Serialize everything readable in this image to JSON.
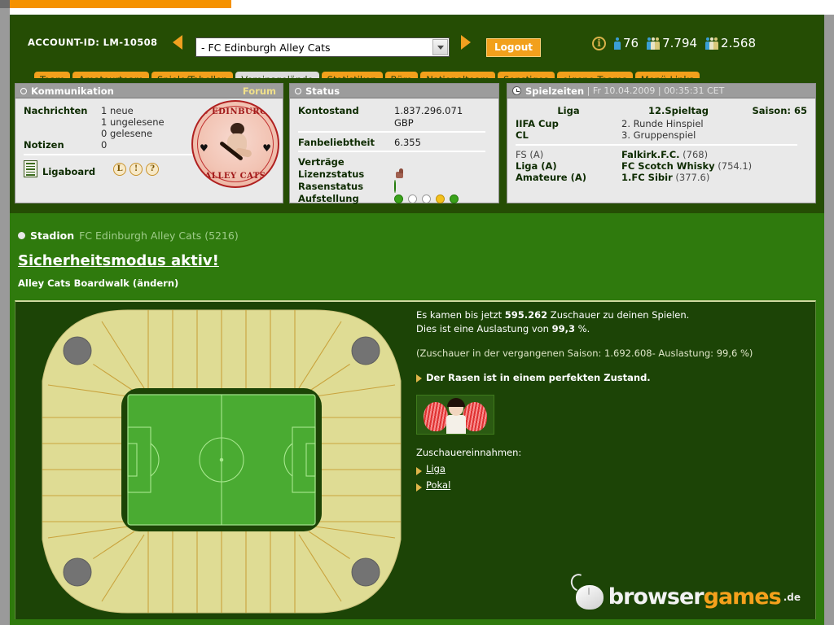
{
  "header": {
    "account_label": "ACCOUNT-ID: LM-10508",
    "team_select_value": "- FC Edinburgh Alley Cats",
    "logout_label": "Logout",
    "info_icon": "info-circle-icon",
    "stat_online": "76",
    "stat_users": "7.794",
    "stat_teams": "2.568"
  },
  "tabs": [
    {
      "label": "Team",
      "active": false
    },
    {
      "label": "Amateurteam",
      "active": false
    },
    {
      "label": "Spiele/Tabellen",
      "active": false
    },
    {
      "label": "Vereinsgelände",
      "active": true
    },
    {
      "label": "Statistiken",
      "active": false
    },
    {
      "label": "Büro",
      "active": false
    },
    {
      "label": "Nationalteam",
      "active": false
    },
    {
      "label": "Sonstiges",
      "active": false
    },
    {
      "label": "eigene Teams",
      "active": false
    },
    {
      "label": "Menü-Links",
      "active": false
    }
  ],
  "kommunikation": {
    "title": "Kommunikation",
    "forum_link": "Forum",
    "nachrichten_label": "Nachrichten",
    "nachrichten_new": "1 neue",
    "nachrichten_unread": "1 ungelesene",
    "nachrichten_read": "0 gelesene",
    "notizen_label": "Notizen",
    "notizen_value": "0",
    "ligaboard_label": "Ligaboard",
    "ligaboard_buttons": [
      "L",
      "!",
      "?"
    ],
    "emblem_top": "FC EDINBURGH",
    "emblem_bottom": "ALLEY CATS"
  },
  "status": {
    "title": "Status",
    "kontostand_label": "Kontostand",
    "kontostand_value": "1.837.296.071",
    "kontostand_currency": "GBP",
    "fanbeliebtheit_label": "Fanbeliebtheit",
    "fanbeliebtheit_value": "6.355",
    "vertraege_label": "Verträge",
    "lizenzstatus_label": "Lizenzstatus",
    "rasenstatus_label": "Rasenstatus",
    "aufstellung_label": "Aufstellung",
    "aufstellung_dots": [
      "green",
      "white",
      "white",
      "yellow",
      "green"
    ],
    "rasen_dot": "green"
  },
  "spielzeiten": {
    "title": "Spielzeiten",
    "date": "Fr 10.04.2009",
    "time": "00:35:31 CET",
    "head_a": "Liga",
    "head_b": "12.Spieltag",
    "head_c": "Saison: 65",
    "rows_top": [
      {
        "name": "IIFA Cup",
        "detail": "2. Runde Hinspiel"
      },
      {
        "name": "CL",
        "detail": "3. Gruppenspiel"
      }
    ],
    "rows_bottom": [
      {
        "name": "FS (A)",
        "light": true,
        "opponent": "Falkirk.F.C.",
        "rating": "(768)"
      },
      {
        "name": "Liga (A)",
        "light": false,
        "opponent": "FC Scotch Whisky",
        "rating": "(754.1)"
      },
      {
        "name": "Amateure (A)",
        "light": false,
        "opponent": "1.FC Sibir",
        "rating": "(377.6)"
      }
    ]
  },
  "stadion": {
    "section_label": "Stadion",
    "section_name": "FC Edinburgh Alley Cats (5216)",
    "security_mode": "Sicherheitsmodus aktiv!",
    "stadium_name": "Alley Cats Boardwalk (",
    "change_link": "ändern",
    "close_paren": ")",
    "attendance_line_a": "Es kamen bis jetzt ",
    "attendance_value": "595.262",
    "attendance_line_b": " Zuschauer zu deinen Spielen.",
    "utilization_line_a": "Dies ist eine Auslastung von ",
    "utilization_value": "99,3",
    "utilization_line_b": " %.",
    "prev_season": "(Zuschauer in der vergangenen Saison: 1.692.608- Auslastung: 99,6 %)",
    "pitch_status": "Der Rasen ist in einem perfekten Zustand.",
    "revenue_label": "Zuschauereinnahmen:",
    "revenue_links": [
      "Liga",
      "Pokal"
    ]
  },
  "footer": {
    "logo_part1": "browser",
    "logo_part2": "games",
    "logo_tld": ".de"
  },
  "colors": {
    "header_green": "#254d04",
    "content_green": "#2f7a0d",
    "stadium_dark": "#1c4406",
    "orange": "#f2a01c",
    "panel_gray": "#e9e9e9"
  }
}
